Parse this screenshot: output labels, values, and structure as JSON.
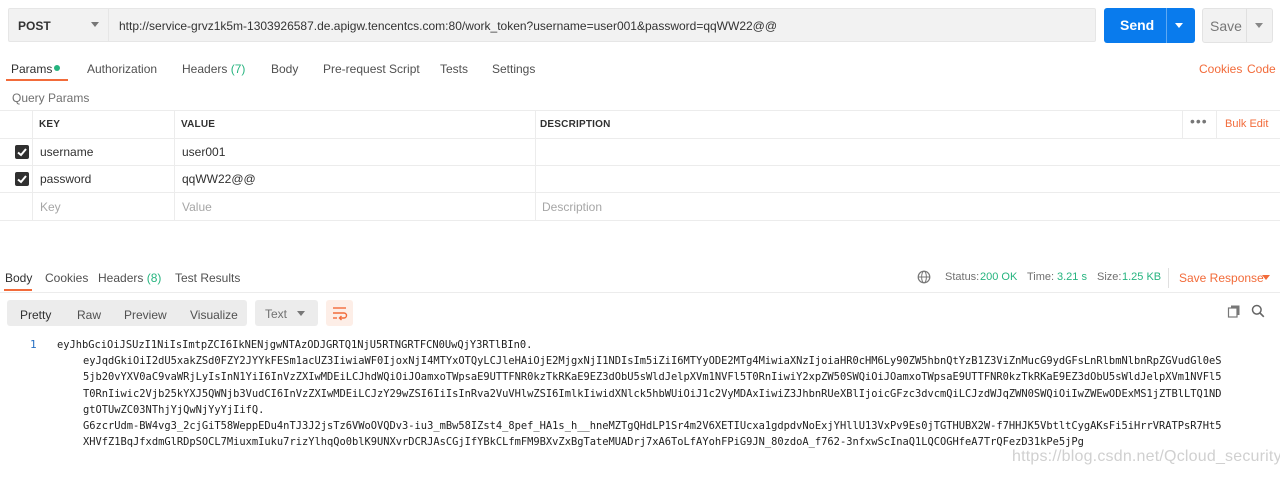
{
  "request": {
    "method": "POST",
    "url": "http://service-grvz1k5m-1303926587.de.apigw.tencentcs.com:80/work_token?username=user001&password=qqWW22@@",
    "send_label": "Send",
    "save_label": "Save"
  },
  "request_tabs": {
    "params": "Params",
    "authorization": "Authorization",
    "headers": "Headers",
    "headers_count": "(7)",
    "body": "Body",
    "prerequest": "Pre-request Script",
    "tests": "Tests",
    "settings": "Settings",
    "cookies": "Cookies",
    "code": "Code"
  },
  "query_params": {
    "section_label": "Query Params",
    "columns": {
      "key": "KEY",
      "value": "VALUE",
      "description": "DESCRIPTION"
    },
    "more_icon": "ellipsis-icon",
    "bulk_edit": "Bulk Edit",
    "rows": [
      {
        "checked": true,
        "key": "username",
        "value": "user001",
        "description": ""
      },
      {
        "checked": true,
        "key": "password",
        "value": "qqWW22@@",
        "description": ""
      }
    ],
    "placeholders": {
      "key": "Key",
      "value": "Value",
      "description": "Description"
    }
  },
  "response_tabs": {
    "body": "Body",
    "cookies": "Cookies",
    "headers": "Headers",
    "headers_count": "(8)",
    "test_results": "Test Results"
  },
  "response_status": {
    "status_label": "Status:",
    "status_value": "200 OK",
    "time_label": "Time:",
    "time_value": "3.21 s",
    "size_label": "Size:",
    "size_value": "1.25 KB",
    "save_response": "Save Response"
  },
  "response_view": {
    "pretty": "Pretty",
    "raw": "Raw",
    "preview": "Preview",
    "visualize": "Visualize",
    "format": "Text",
    "line_number": "1",
    "body_lines": [
      "eyJhbGciOiJSUzI1NiIsImtpZCI6IkNENjgwNTAzODJGRTQ1NjU5RTNGRTFCN0UwQjY3RTlBIn0.",
      "eyJqdGkiOiI2dU5xakZSd0FZY2JYYkFESm1acUZ3IiwiaWF0IjoxNjI4MTYxOTQyLCJleHAiOjE2MjgxNjI1NDIsIm5iZiI6MTYyODE2MTg4MiwiaXNzIjoiaHR0cHM6Ly90ZW5hbnQtYzB1Z3ViZnMucG9ydGFsLnRlbmNlbnRpZGVudGl0eS",
      "5jb20vYXV0aC9vaWRjLyIsInN1YiI6InVzZXIwMDEiLCJhdWQiOiJOamxoTWpsaE9UTTFNR0kzTkRKaE9EZ3dObU5sWldJelpXVm1NVFl5T0RnIiwiY2xpZW50SWQiOiJOamxoTWpsaE9UTTFNR0kzTkRKaE9EZ3dObU5sWldJelpXVm1NVFl5",
      "T0RnIiwic2Vjb25kYXJ5QWNjb3VudCI6InVzZXIwMDEiLCJzY29wZSI6IiIsInRva2VuVHlwZSI6ImlkIiwidXNlck5hbWUiOiJ1c2VyMDAxIiwiZ3JhbnRUeXBlIjoicGFzc3dvcmQiLCJzdWJqZWN0SWQiOiIwZWEwODExMS1jZTBlLTQ1ND",
      "gtOTUwZC03NThjYjQwNjYyYjIifQ.",
      "G6zcrUdm-BW4vg3_2cjGiT58WeppEDu4nTJ3J2jsTz6VWoOVQDv3-iu3_mBw58IZst4_8pef_HA1s_h__hneMZTgQHdLP1Sr4m2V6XETIUcxa1gdpdvNoExjYHllU13VxPv9Es0jTGTHUBX2W-f7HHJK5VbtltCygAKsFi5iHrrVRATPsR7Ht5",
      "XHVfZ1BqJfxdmGlRDpSOCL7MiuxmIuku7rizYlhqQo0blK9UNXvrDCRJAsCGjIfYBkCLfmFM9BXvZxBgTateMUADrj7xA6ToLfAYohFPiG9JN_80zdoA_f762-3nfxwScInaQ1LQCOGHfeA7TrQFezD31kPe5jPg"
    ]
  },
  "watermark": "https://blog.csdn.net/Qcloud_security"
}
